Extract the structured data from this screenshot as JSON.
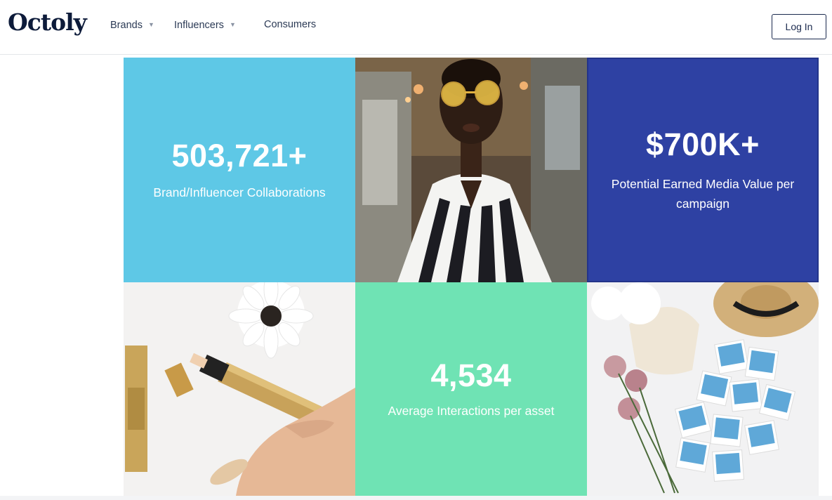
{
  "brand": {
    "logo_text": "Octoly"
  },
  "nav": {
    "items": [
      {
        "label": "Brands",
        "has_dropdown": true
      },
      {
        "label": "Influencers",
        "has_dropdown": true
      },
      {
        "label": "Consumers",
        "has_dropdown": false
      }
    ],
    "login_label": "Log In"
  },
  "stats": {
    "collaborations": {
      "value": "503,721+",
      "label": "Brand/Influencer Collaborations"
    },
    "media_value": {
      "value": "$700K+",
      "label": "Potential Earned Media Value per campaign"
    },
    "interactions": {
      "value": "4,534",
      "label": "Average Interactions per asset"
    }
  },
  "colors": {
    "sky_blue": "#5ec8e6",
    "navy": "#2e41a3",
    "mint": "#6fe3b4",
    "text_dark": "#1b2a4e"
  },
  "icons": {
    "dropdown": "chevron-down-icon"
  }
}
